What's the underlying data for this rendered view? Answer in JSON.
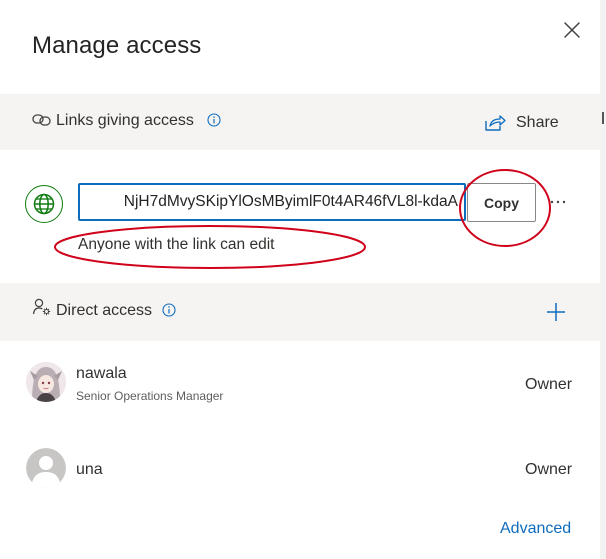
{
  "dialog": {
    "title": "Manage access"
  },
  "links_section": {
    "label": "Links giving access",
    "share_label": "Share",
    "link": {
      "url_visible": "NjH7dMvySKipYlOsMByimlF0t4AR46fVL8l-kdaA",
      "copy_label": "Copy",
      "description": "Anyone with the link can edit"
    }
  },
  "direct_section": {
    "label": "Direct access",
    "people": [
      {
        "name": "nawala",
        "role": "Senior Operations Manager",
        "permission": "Owner"
      },
      {
        "name": "una",
        "role": "",
        "permission": "Owner"
      }
    ]
  },
  "footer": {
    "advanced_label": "Advanced"
  },
  "colors": {
    "accent": "#0f6cbd",
    "annotation": "#d0021b",
    "globe": "#107c10",
    "band": "#f5f4f3"
  },
  "icons": [
    "close-icon",
    "link-icon",
    "info-icon",
    "share-icon",
    "globe-icon",
    "more-icon",
    "people-settings-icon",
    "add-icon",
    "avatar"
  ]
}
